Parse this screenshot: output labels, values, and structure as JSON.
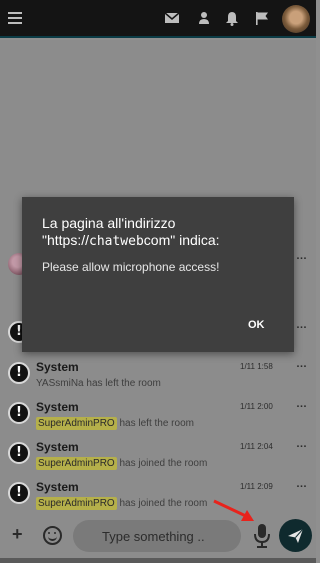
{
  "topbar": {
    "icons": [
      "menu-icon",
      "mail-icon",
      "user-icon",
      "bell-icon",
      "flag-icon"
    ],
    "colors": {
      "bar": "#141414",
      "icon": "#bdbdbd",
      "accent": "#0c3c46"
    }
  },
  "messages": [
    {
      "name": "System",
      "time": "1/11 1:58",
      "highlight": "",
      "text": "YASsmiNa has left the room"
    },
    {
      "name": "System",
      "time": "1/11 2:00",
      "highlight": "SuperAdminPRO",
      "text": "has left the room"
    },
    {
      "name": "System",
      "time": "1/11 2:04",
      "highlight": "SuperAdminPRO",
      "text": "has joined the room"
    },
    {
      "name": "System",
      "time": "1/11 2:09",
      "highlight": "SuperAdminPRO",
      "text": "has joined the room"
    }
  ],
  "message_menu": "…",
  "dialog": {
    "title_line1": "La pagina all'indirizzo",
    "title_q1": "\"https://",
    "title_host": "chatweb",
    "title_q2": "com\" indica:",
    "body": "Please allow microphone access!",
    "ok_label": "OK"
  },
  "composer": {
    "plus_label": "+",
    "placeholder": "Type something ..",
    "colors": {
      "send": "#0f2a2e",
      "annotation_arrow": "#e8231c"
    }
  }
}
